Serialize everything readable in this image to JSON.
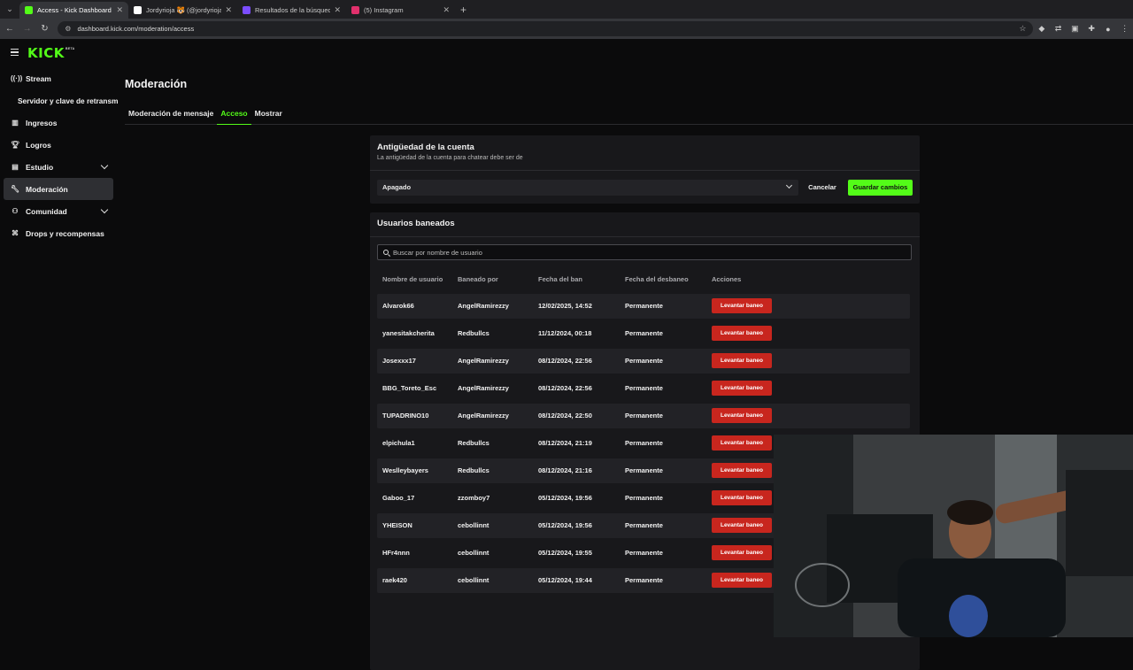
{
  "browser": {
    "tabs": [
      {
        "title": "Access - Kick Dashboard",
        "favicon_color": "#53fc18",
        "active": true
      },
      {
        "title": "Jordyrioja 🐯 (@jordyrioja) | TikTok",
        "favicon_color": "#ffffff",
        "active": false
      },
      {
        "title": "Resultados de la búsqueda de",
        "favicon_color": "#7b4dff",
        "active": false
      },
      {
        "title": "(5) Instagram",
        "favicon_color": "#e1306c",
        "active": false
      }
    ],
    "url": "dashboard.kick.com/moderation/access"
  },
  "brand": {
    "logo": "KICK",
    "badge": "BETA",
    "accent": "#53fc18"
  },
  "sidebar": {
    "items": [
      {
        "label": "Stream",
        "icon": "broadcast-icon"
      },
      {
        "label": "Servidor y clave de retransmisión",
        "icon": ""
      },
      {
        "label": "Ingresos",
        "icon": "wallet-icon"
      },
      {
        "label": "Logros",
        "icon": "trophy-icon"
      },
      {
        "label": "Estudio",
        "icon": "studio-icon"
      },
      {
        "label": "Moderación",
        "icon": "wrench-icon"
      },
      {
        "label": "Comunidad",
        "icon": "community-icon"
      },
      {
        "label": "Drops y recompensas",
        "icon": "gift-icon"
      }
    ]
  },
  "page": {
    "title": "Moderación",
    "tabs": [
      "Moderación de mensaje",
      "Acceso",
      "Mostrar"
    ],
    "active_tab": "Acceso"
  },
  "account_age": {
    "title": "Antigüedad de la cuenta",
    "subtitle": "La antigüedad de la cuenta para chatear debe ser de",
    "selected": "Apagado",
    "cancel": "Cancelar",
    "save": "Guardar cambios"
  },
  "banned": {
    "title": "Usuarios baneados",
    "search_placeholder": "Buscar por nombre de usuario",
    "columns": [
      "Nombre de usuario",
      "Baneado por",
      "Fecha del ban",
      "Fecha del desbaneo",
      "Acciones"
    ],
    "action_label": "Levantar baneo",
    "action_color": "#c8261e",
    "rows": [
      {
        "user": "Alvarok66",
        "by": "AngelRamirezzy",
        "date": "12/02/2025, 14:52",
        "until": "Permanente"
      },
      {
        "user": "yanesitakcherita",
        "by": "Redbullcs",
        "date": "11/12/2024, 00:18",
        "until": "Permanente"
      },
      {
        "user": "Josexxx17",
        "by": "AngelRamirezzy",
        "date": "08/12/2024, 22:56",
        "until": "Permanente"
      },
      {
        "user": "BBG_Toreto_Esc",
        "by": "AngelRamirezzy",
        "date": "08/12/2024, 22:56",
        "until": "Permanente"
      },
      {
        "user": "TUPADRINO10",
        "by": "AngelRamirezzy",
        "date": "08/12/2024, 22:50",
        "until": "Permanente"
      },
      {
        "user": "elpichula1",
        "by": "Redbullcs",
        "date": "08/12/2024, 21:19",
        "until": "Permanente"
      },
      {
        "user": "Weslleybayers",
        "by": "Redbullcs",
        "date": "08/12/2024, 21:16",
        "until": "Permanente"
      },
      {
        "user": "Gaboo_17",
        "by": "zzomboy7",
        "date": "05/12/2024, 19:56",
        "until": "Permanente"
      },
      {
        "user": "YHEISON",
        "by": "cebollinnt",
        "date": "05/12/2024, 19:56",
        "until": "Permanente"
      },
      {
        "user": "HFr4nnn",
        "by": "cebollinnt",
        "date": "05/12/2024, 19:55",
        "until": "Permanente"
      },
      {
        "user": "raek420",
        "by": "cebollinnt",
        "date": "05/12/2024, 19:44",
        "until": "Permanente"
      }
    ]
  }
}
